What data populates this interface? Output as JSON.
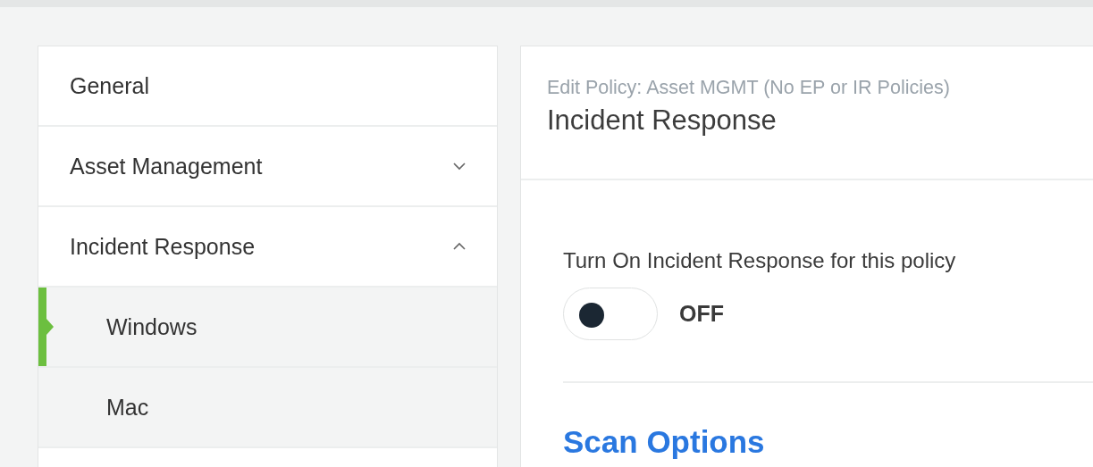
{
  "sidebar": {
    "items": [
      {
        "label": "General",
        "selected": false
      },
      {
        "label": "Asset Management",
        "expanded": false,
        "selected": false
      },
      {
        "label": "Incident Response",
        "expanded": true,
        "selected": false,
        "children": [
          {
            "label": "Windows",
            "selected": true
          },
          {
            "label": "Mac",
            "selected": false
          }
        ]
      }
    ]
  },
  "panel": {
    "breadcrumb": "Edit Policy: Asset MGMT (No EP or IR Policies)",
    "title": "Incident Response",
    "toggle": {
      "label": "Turn On Incident Response for this policy",
      "on": false,
      "state_text": "OFF"
    },
    "section_title": "Scan Options"
  }
}
